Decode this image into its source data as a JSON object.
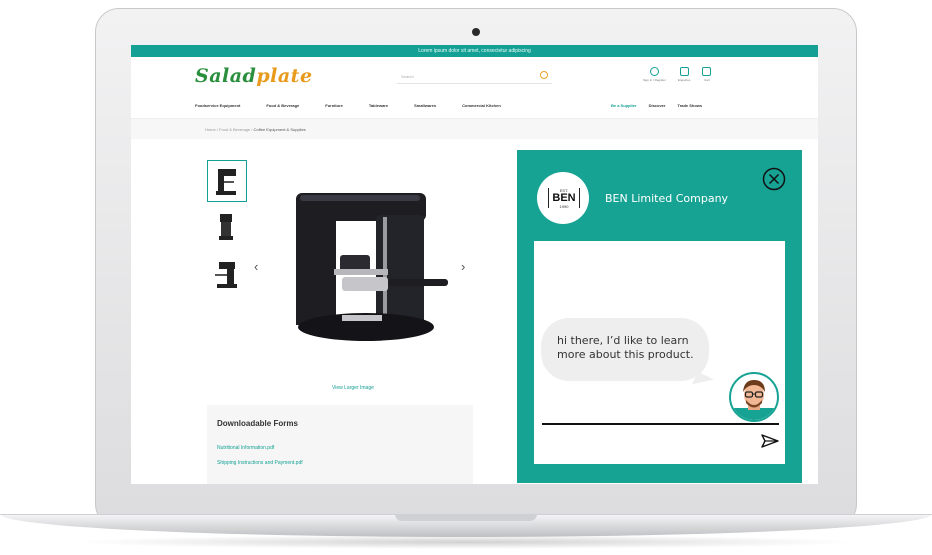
{
  "site": {
    "promo_text": "Lorem ipsum dolor sit amet, consectetur adipiscing",
    "logo_main": "Salad",
    "logo_accent": "plate",
    "search_placeholder": "Search",
    "header_icons": [
      {
        "label": "Sign in / Register",
        "icon": "user-icon"
      },
      {
        "label": "Enquiries",
        "icon": "chat-icon"
      },
      {
        "label": "Cart",
        "icon": "cart-icon"
      }
    ],
    "nav": [
      "Foodservice Equipment",
      "Food & Beverage",
      "Furniture",
      "Tableware",
      "Smallwares",
      "Commercial Kitchen"
    ],
    "nav_right": [
      {
        "label": "Be a Supplier",
        "highlight": true
      },
      {
        "label": "Discover",
        "highlight": false
      },
      {
        "label": "Trade Shows",
        "highlight": false
      }
    ],
    "breadcrumb": {
      "parts": "Home  /  Food & Beverage  /",
      "current": "Coffee Equipment & Supplies"
    },
    "view_larger": "View Larger Image",
    "forms": {
      "title": "Downloadable Forms",
      "links": [
        "Nutritional Information.pdf",
        "Shipping Instructions and Payment.pdf"
      ]
    },
    "accent_color": "#15a095"
  },
  "chat": {
    "company": "BEN Limited Company",
    "logo": {
      "est": "EST.",
      "name": "BEN",
      "year": "1990"
    },
    "message": "hi there, I’d like to learn more about this product.",
    "close_icon": "close-circle-icon",
    "send_icon": "send-icon",
    "bg_color": "#17a394"
  }
}
